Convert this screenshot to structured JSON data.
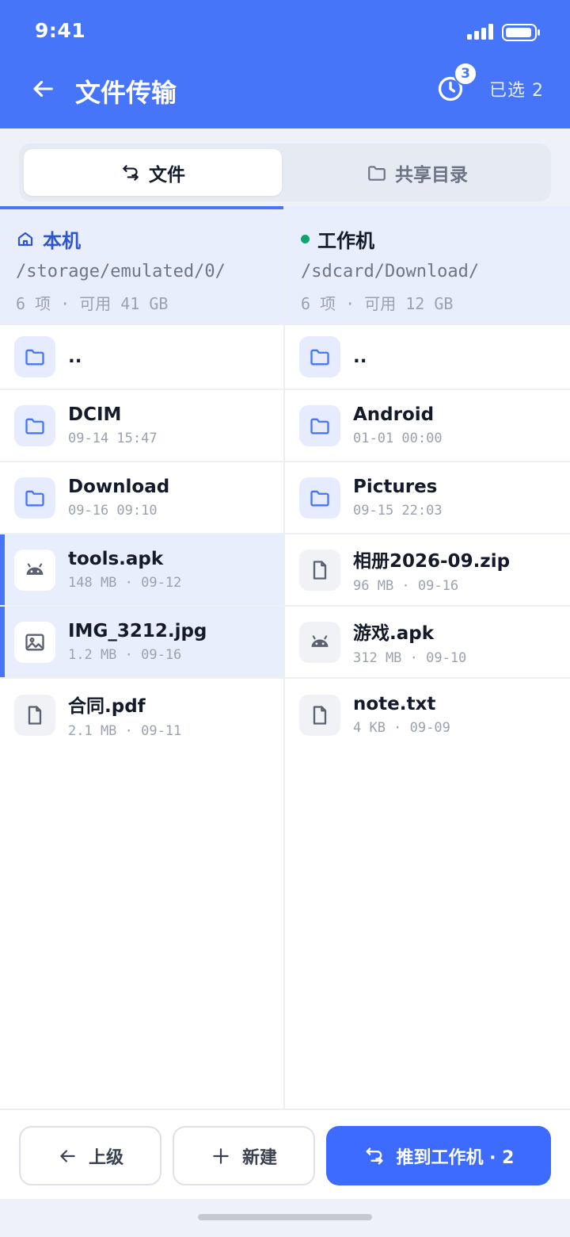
{
  "status": {
    "time": "9:41"
  },
  "header": {
    "title": "文件传输",
    "history_badge": "3",
    "selected_label": "已选",
    "selected_count": "2"
  },
  "tabs": [
    {
      "label": "文件",
      "active": true
    },
    {
      "label": "共享目录",
      "active": false
    }
  ],
  "local": {
    "title": "本机",
    "path": "/storage/emulated/0/",
    "meta": "6 项 · 可用 41 GB",
    "rows": [
      {
        "name": "..",
        "meta": "",
        "icon": "folder-icon"
      },
      {
        "name": "DCIM",
        "meta": "09-14 15:47",
        "icon": "folder-icon"
      },
      {
        "name": "Download",
        "meta": "09-16 09:10",
        "icon": "folder-icon"
      },
      {
        "name": "tools.apk",
        "meta": "148 MB · 09-12",
        "icon": "android-icon",
        "selected": true
      },
      {
        "name": "IMG_3212.jpg",
        "meta": "1.2 MB · 09-16",
        "icon": "image-icon",
        "selected": true
      },
      {
        "name": "合同.pdf",
        "meta": "2.1 MB · 09-11",
        "icon": "document-icon"
      }
    ]
  },
  "remote": {
    "title": "工作机",
    "status_color": "#13a36a",
    "path": "/sdcard/Download/",
    "meta": "6 项 · 可用 12 GB",
    "rows": [
      {
        "name": "..",
        "meta": "",
        "icon": "folder-icon"
      },
      {
        "name": "Android",
        "meta": "01-01 00:00",
        "icon": "folder-icon"
      },
      {
        "name": "Pictures",
        "meta": "09-15 22:03",
        "icon": "folder-icon"
      },
      {
        "name": "相册2026-09.zip",
        "meta": "96 MB · 09-16",
        "icon": "document-icon"
      },
      {
        "name": "游戏.apk",
        "meta": "312 MB · 09-10",
        "icon": "android-icon"
      },
      {
        "name": "note.txt",
        "meta": "4 KB · 09-09",
        "icon": "document-icon"
      }
    ]
  },
  "bottom": {
    "up_label": "上级",
    "new_label": "新建",
    "push_label": "推到工作机 · 2"
  },
  "colors": {
    "accent": "#4775fa",
    "selected_bg": "#e9eefc"
  }
}
